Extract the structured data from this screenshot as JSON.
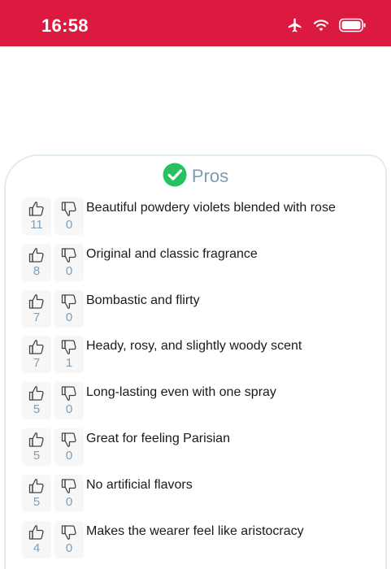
{
  "status_bar": {
    "time": "16:58",
    "icons": [
      "airplane-icon",
      "wifi-icon",
      "battery-icon"
    ],
    "color": "#dc1a3f"
  },
  "pros": {
    "title": "Pros",
    "check_color": "#25c261",
    "items": [
      {
        "text": "Beautiful powdery violets blended with rose",
        "likes": "11",
        "dislikes": "0"
      },
      {
        "text": "Original and classic fragrance",
        "likes": "8",
        "dislikes": "0"
      },
      {
        "text": "Bombastic and flirty",
        "likes": "7",
        "dislikes": "0"
      },
      {
        "text": "Heady, rosy, and slightly woody scent",
        "likes": "7",
        "dislikes": "1"
      },
      {
        "text": "Long-lasting even with one spray",
        "likes": "5",
        "dislikes": "0"
      },
      {
        "text": "Great for feeling Parisian",
        "likes": "5",
        "dislikes": "0"
      },
      {
        "text": "No artificial flavors",
        "likes": "5",
        "dislikes": "0"
      },
      {
        "text": "Makes the wearer feel like aristocracy",
        "likes": "4",
        "dislikes": "0"
      }
    ]
  }
}
